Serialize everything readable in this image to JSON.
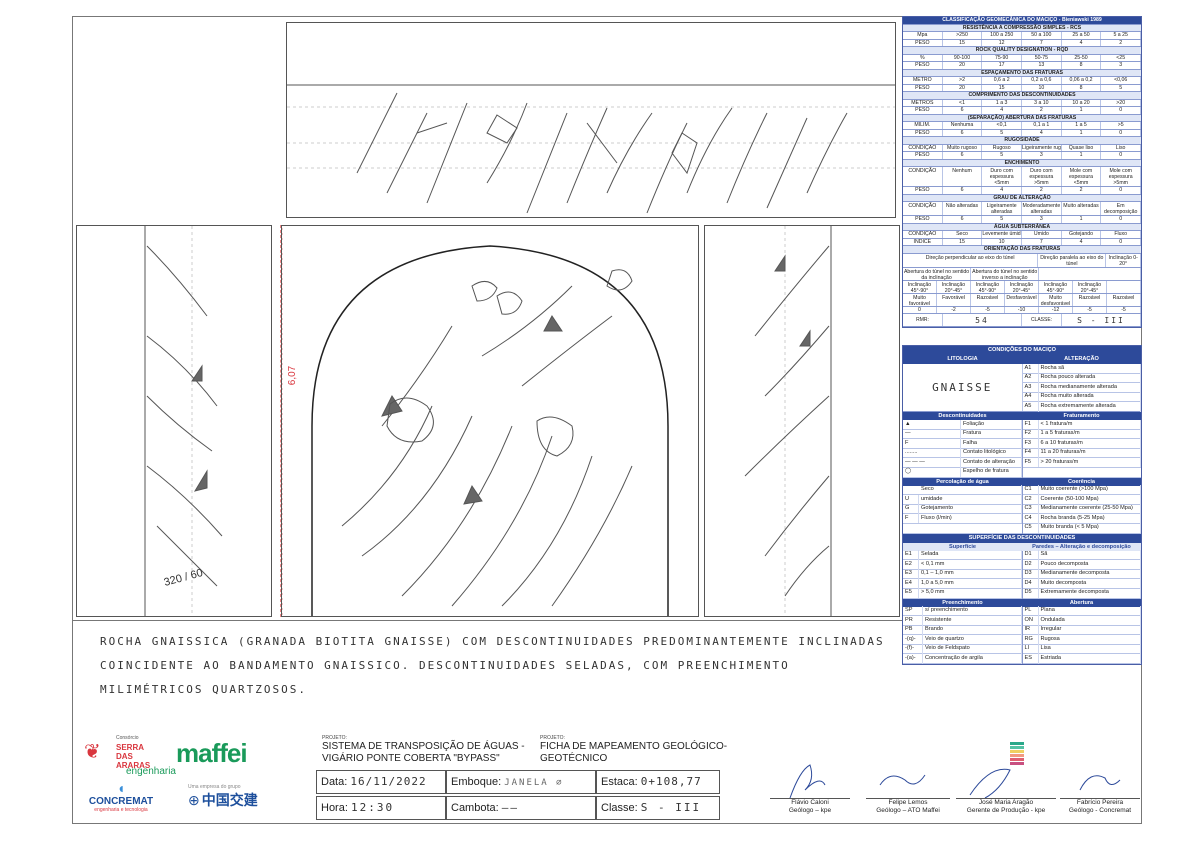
{
  "classification": {
    "title": "CLASSIFICAÇÃO GEOMECÂNICA DO MACIÇO - Bieniawski 1989",
    "rcs": {
      "title": "RESISTÊNCIA A COMPRESSÃO SIMPLES - RCS",
      "unit": "Mpa",
      "weight": "PESO",
      "ranges": [
        ">250",
        "100 a 250",
        "50 a 100",
        "25 a 50",
        "5 a 25"
      ],
      "weights": [
        "15",
        "12",
        "7",
        "4",
        "2"
      ]
    },
    "rqd": {
      "title": "ROCK QUALITY DESIGNATION - RQD",
      "unit": "%",
      "ranges": [
        "90-100",
        "75-90",
        "50-75",
        "25-50",
        "<25"
      ],
      "weights": [
        "20",
        "17",
        "13",
        "8",
        "3"
      ]
    },
    "spacing": {
      "title": "ESPAÇAMENTO DAS FRATURAS",
      "unit": "METRO",
      "ranges": [
        ">2",
        "0,6 a 2",
        "0,2 a 0,6",
        "0,06 a 0,2",
        "<0,06"
      ],
      "weights": [
        "20",
        "15",
        "10",
        "8",
        "5"
      ]
    },
    "length": {
      "title": "COMPRIMENTO DAS DESCONTINUIDADES",
      "unit": "METROS",
      "ranges": [
        "<1",
        "1 a 3",
        "3 a 10",
        "10 a 20",
        ">20"
      ],
      "weights": [
        "6",
        "4",
        "2",
        "1",
        "0"
      ]
    },
    "aperture": {
      "title": "(SEPARAÇÃO) ABERTURA DAS FRATURAS",
      "unit": "MILIM.",
      "ranges": [
        "Nenhuma",
        "<0,1",
        "0,1 a 1",
        "1 a 5",
        ">5"
      ],
      "weights": [
        "6",
        "5",
        "4",
        "1",
        "0"
      ]
    },
    "roughness": {
      "title": "RUGOSIDADE",
      "unit": "CONDIÇÃO",
      "ranges": [
        "Muito rugoso",
        "Rugoso",
        "Ligeiramente rugoso",
        "Quase liso",
        "Liso"
      ],
      "weights": [
        "6",
        "5",
        "3",
        "1",
        "0"
      ]
    },
    "filling": {
      "title": "ENCHIMENTO",
      "unit": "CONDIÇÃO",
      "ranges": [
        "Nenhum",
        "Duro com espessura <5mm",
        "Duro com espessura >5mm",
        "Mole com espessura <5mm",
        "Mole com espessura >5mm"
      ],
      "weights": [
        "6",
        "4",
        "2",
        "2",
        "0"
      ]
    },
    "weathering": {
      "title": "GRAU DE ALTERAÇÃO",
      "unit": "CONDIÇÃO",
      "ranges": [
        "Não alteradas",
        "Ligeiramente alteradas",
        "Moderadamente alteradas",
        "Muito alteradas",
        "Em decomposição"
      ],
      "weights": [
        "6",
        "5",
        "3",
        "1",
        "0"
      ]
    },
    "water": {
      "title": "ÁGUA SUBTERRÂNEA",
      "unit": "CONDIÇÃO",
      "index": "ÍNDICE",
      "ranges": [
        "Seco",
        "Levemente úmido",
        "Úmido",
        "Gotejando",
        "Fluxo"
      ],
      "weights": [
        "15",
        "10",
        "7",
        "4",
        "0"
      ]
    },
    "orientation": {
      "title": "ORIENTAÇÃO DAS FRATURAS",
      "perp": "Direção perpendicular ao eixo do túnel",
      "parallel": "Direção paralela ao eixo do túnel",
      "dip": "Inclinação 0-20°",
      "h1": "Abertura do túnel no sentido da inclinação",
      "h2": "Abertura do túnel no sentido inverso a inclinação",
      "cells": [
        "Inclinação 45°-90°",
        "Inclinação 20°-45°",
        "Inclinação 45°-90°",
        "Inclinação 20°-45°",
        "Inclinação 45°-90°",
        "Inclinação 20°-45°",
        ""
      ],
      "ratings": [
        "Muito favorável",
        "Favorável",
        "Razoável",
        "Desfavorável",
        "Muito desfavorável",
        "Razoável",
        "Razoável"
      ],
      "values": [
        "0",
        "-2",
        "-5",
        "-10",
        "-12",
        "-5",
        "-5"
      ]
    },
    "rmr_label": "RMR:",
    "rmr_value": "54",
    "class_label": "CLASSE:",
    "class_value": "S - III"
  },
  "legend": {
    "title": "CONDIÇÕES DO MACIÇO",
    "lithology_h": "LITOLOGIA",
    "alteration_h": "ALTERAÇÃO",
    "lithology": "GNAISSE",
    "alterations": [
      [
        "A1",
        "Rocha sã"
      ],
      [
        "A2",
        "Rocha pouco alterada"
      ],
      [
        "A3",
        "Rocha medianamente alterada"
      ],
      [
        "A4",
        "Rocha muito alterada"
      ],
      [
        "A5",
        "Rocha extremamente alterada"
      ]
    ],
    "disc_h": "Descontinuidades",
    "frac_h": "Fraturamento",
    "discs": [
      "Foliação",
      "Fratura",
      "Falha",
      "Contato litológico",
      "Contato de alteração",
      "Espelho de fratura"
    ],
    "fracs": [
      [
        "F1",
        "< 1 fratura/m"
      ],
      [
        "F2",
        "1 a 5 fraturas/m"
      ],
      [
        "F3",
        "6 a 10 fraturas/m"
      ],
      [
        "F4",
        "11 a 20 fraturas/m"
      ],
      [
        "F5",
        "> 20 fraturas/m"
      ]
    ],
    "water_h": "Percolação de água",
    "coh_h": "Coerência",
    "waters": [
      [
        "",
        "Seco"
      ],
      [
        "U",
        "umidade"
      ],
      [
        "G",
        "Gotejamento"
      ],
      [
        "F",
        "Fluxo (l/min)"
      ],
      [
        "",
        ""
      ]
    ],
    "cohs": [
      [
        "C1",
        "Muito coerente (>100 Mpa)"
      ],
      [
        "C2",
        "Coerente (50-100 Mpa)"
      ],
      [
        "C3",
        "Medianamente coerente (25-50 Mpa)"
      ],
      [
        "C4",
        "Rocha branda (5-25 Mpa)"
      ],
      [
        "C5",
        "Muito branda (< 5 Mpa)"
      ]
    ],
    "surf_title": "SUPERFÍCIE DAS DESCONTINUIDADES",
    "surf_h": "Superfície",
    "walls_h": "Paredes – Alteração e decomposição",
    "surfs": [
      [
        "E1",
        "Selada"
      ],
      [
        "E2",
        "< 0,1 mm"
      ],
      [
        "E3",
        "0,1 – 1,0 mm"
      ],
      [
        "E4",
        "1,0 a 5,0 mm"
      ],
      [
        "E5",
        "> 5,0 mm"
      ]
    ],
    "walls": [
      [
        "D1",
        "Sã"
      ],
      [
        "D2",
        "Pouco decomposta"
      ],
      [
        "D3",
        "Medianamente decomposta"
      ],
      [
        "D4",
        "Muito decomposta"
      ],
      [
        "D5",
        "Extremamente decomposta"
      ]
    ],
    "fill_h": "Preenchimento",
    "ab_h": "Abertura",
    "fills": [
      [
        "SP",
        "s/ preenchimento"
      ],
      [
        "PR",
        "Resistente"
      ],
      [
        "PB",
        "Brando"
      ],
      [
        "-(q)-",
        "Veio de quartzo"
      ],
      [
        "-(f)-",
        "Veio de Feldspato"
      ],
      [
        "-(a)-",
        "Concentração de argila"
      ]
    ],
    "abs": [
      [
        "PL",
        "Plana"
      ],
      [
        "ON",
        "Ondulada"
      ],
      [
        "IR",
        "Irregular"
      ],
      [
        "RG",
        "Rugosa"
      ],
      [
        "LI",
        "Lisa"
      ],
      [
        "ES",
        "Estriada"
      ]
    ]
  },
  "drawing": {
    "height_label": "6,07",
    "strike_label": "320 / 60"
  },
  "description": [
    "ROCHA GNAISSICA (GRANADA BIOTITA GNAISSE) COM DESCONTINUIDADES PREDOMINANTEMENTE INCLINADAS",
    "COINCIDENTE AO BANDAMENTO GNAISSICO. DESCONTINUIDADES SELADAS, COM PREENCHIMENTO",
    "MILIMÉTRICOS QUARTZOSOS."
  ],
  "project": {
    "label": "PROJETO:",
    "name": "SISTEMA DE TRANSPOSIÇÃO DE ÁGUAS - VIGÁRIO PONTE COBERTA \"BYPASS\"",
    "label2": "PROJETO:",
    "sheet": "FICHA DE MAPEAMENTO GEOLÓGICO-GEOTÉCNICO"
  },
  "fields": {
    "data_label": "Data:",
    "data_value": "16/11/2022",
    "emboque_label": "Emboque:",
    "emboque_value": "JANELA ∅",
    "estaca_label": "Estaca:",
    "estaca_value": "0+108,77",
    "hora_label": "Hora:",
    "hora_value": "12:30",
    "cambota_label": "Cambota:",
    "cambota_value": "——",
    "classe_label": "Classe:",
    "classe_value": "S - III"
  },
  "signatures": [
    {
      "name": "Flávio Caloni",
      "role": "Geólogo – kpe"
    },
    {
      "name": "Felipe Lemos",
      "role": "Geólogo – ATO Maffei"
    },
    {
      "name": "José Maria Aragão",
      "role": "Gerente de Produção - kpe"
    },
    {
      "name": "Fabrício Pereira",
      "role": "Geólogo - Concremat"
    }
  ],
  "logos": {
    "consortium": "Consórcio",
    "serra": "SERRA DAS ARARAS",
    "maffei": "maffei",
    "maffei_sub": "engenharia",
    "concremat": "CONCREMAT",
    "concremat_sub": "engenharia e tecnologia",
    "crcc": "中国交建",
    "crcc_pre": "Uma empresa do grupo"
  },
  "colors": {
    "header_blue": "#2d4a9a",
    "light_blue": "#dfe6f6",
    "maffei_green": "#1a9a5a",
    "concremat_blue": "#1d4f9c",
    "red": "#d9363e"
  }
}
